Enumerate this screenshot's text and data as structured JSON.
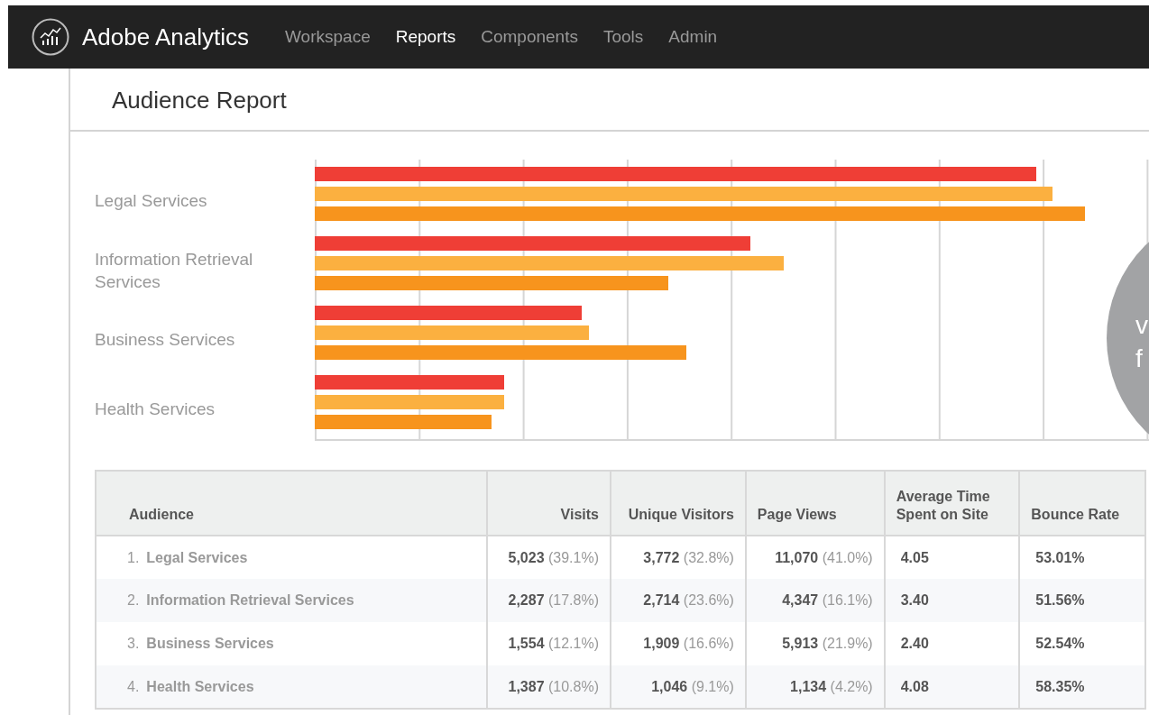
{
  "app": {
    "title": "Adobe Analytics"
  },
  "nav": [
    {
      "label": "Workspace",
      "selected": false
    },
    {
      "label": "Reports",
      "selected": true
    },
    {
      "label": "Components",
      "selected": false
    },
    {
      "label": "Tools",
      "selected": false
    },
    {
      "label": "Admin",
      "selected": false
    }
  ],
  "page_title": "Audience Report",
  "chart": {
    "categories": [
      "Legal Services",
      "Information Retrieval Services",
      "Business Services",
      "Health Services"
    ]
  },
  "overlay": {
    "lines": [
      "v",
      "f"
    ]
  },
  "table": {
    "columns": [
      "Audience",
      "Visits",
      "Unique Visitors",
      "Page Views",
      "Average Time Spent on Site",
      "Bounce Rate"
    ],
    "rows": [
      {
        "index": "1.",
        "audience": "Legal Services",
        "visits": [
          "5,023",
          "(39.1%)"
        ],
        "unique_visitors": [
          "3,772",
          "(32.8%)"
        ],
        "page_views": [
          "11,070",
          "(41.0%)"
        ],
        "avg_time": "4.05",
        "bounce_rate": "53.01%"
      },
      {
        "index": "2.",
        "audience": "Information Retrieval Services",
        "visits": [
          "2,287",
          "(17.8%)"
        ],
        "unique_visitors": [
          "2,714",
          "(23.6%)"
        ],
        "page_views": [
          "4,347",
          "(16.1%)"
        ],
        "avg_time": "3.40",
        "bounce_rate": "51.56%"
      },
      {
        "index": "3.",
        "audience": "Business Services",
        "visits": [
          "1,554",
          "(12.1%)"
        ],
        "unique_visitors": [
          "1,909",
          "(16.6%)"
        ],
        "page_views": [
          "5,913",
          "(21.9%)"
        ],
        "avg_time": "2.40",
        "bounce_rate": "52.54%"
      },
      {
        "index": "4.",
        "audience": "Health Services",
        "visits": [
          "1,387",
          "(10.8%)"
        ],
        "unique_visitors": [
          "1,046",
          "(9.1%)"
        ],
        "page_views": [
          "1,134",
          "(4.2%)"
        ],
        "avg_time": "4.08",
        "bounce_rate": "58.35%"
      }
    ]
  }
}
